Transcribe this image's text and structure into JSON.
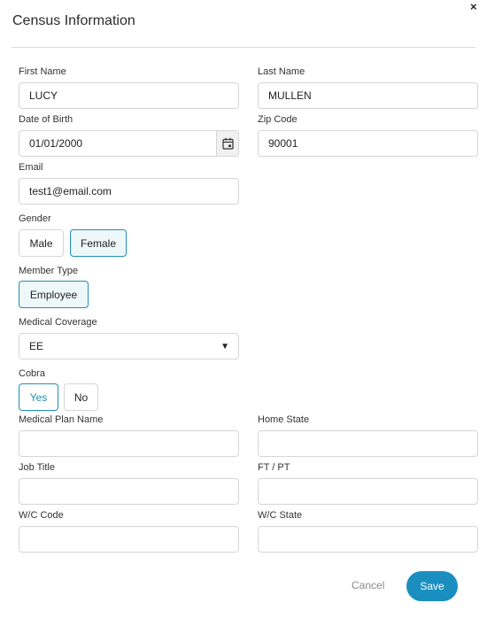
{
  "dialog": {
    "title": "Census Information",
    "close_glyph": "×"
  },
  "fields": {
    "first_name": {
      "label": "First Name",
      "value": "LUCY"
    },
    "last_name": {
      "label": "Last Name",
      "value": "MULLEN"
    },
    "dob": {
      "label": "Date of Birth",
      "value": "01/01/2000",
      "icon": "calendar-icon"
    },
    "zip": {
      "label": "Zip Code",
      "value": "90001"
    },
    "email": {
      "label": "Email",
      "value": "test1@email.com"
    },
    "gender": {
      "label": "Gender",
      "options": [
        "Male",
        "Female"
      ],
      "selected": "Female"
    },
    "member_type": {
      "label": "Member Type",
      "options": [
        "Employee"
      ],
      "selected": "Employee"
    },
    "medical_coverage": {
      "label": "Medical Coverage",
      "value": "EE",
      "arrow": "▼"
    },
    "cobra": {
      "label": "Cobra",
      "options": [
        "Yes",
        "No"
      ],
      "selected": "Yes"
    },
    "medical_plan_name": {
      "label": "Medical Plan Name",
      "value": ""
    },
    "home_state": {
      "label": "Home State",
      "value": ""
    },
    "job_title": {
      "label": "Job Title",
      "value": ""
    },
    "ft_pt": {
      "label": "FT / PT",
      "value": ""
    },
    "wc_code": {
      "label": "W/C Code",
      "value": ""
    },
    "wc_state": {
      "label": "W/C State",
      "value": ""
    }
  },
  "actions": {
    "cancel_label": "Cancel",
    "save_label": "Save"
  },
  "colors": {
    "accent": "#1a8fbf",
    "selected_bg": "#eef8fb",
    "border": "#d6d6d6"
  }
}
